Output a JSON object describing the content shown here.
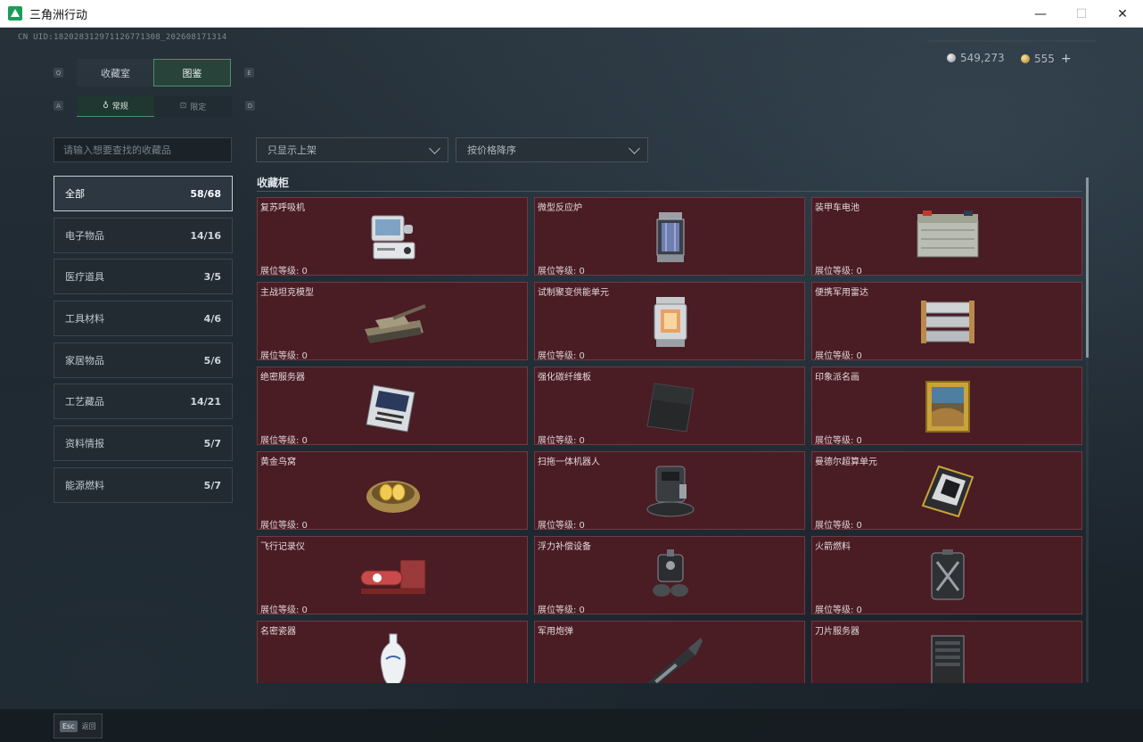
{
  "window": {
    "title": "三角洲行动",
    "minimize": "—",
    "maximize": "☐",
    "close": "✕"
  },
  "header": {
    "uid": "CN UID:1820283129711267713­08_202608171314",
    "silver": "549,273",
    "gold": "555",
    "plus": "+"
  },
  "tabs": {
    "prev_key": "Q",
    "next_key": "E",
    "items": [
      {
        "label": "收藏室",
        "active": false
      },
      {
        "label": "图鉴",
        "active": true
      }
    ]
  },
  "subtabs": {
    "prev_key": "A",
    "next_key": "D",
    "items": [
      {
        "label": "常规",
        "icon": "bag-icon",
        "glyph": "♁",
        "active": true
      },
      {
        "label": "限定",
        "icon": "limited-icon",
        "glyph": "⊡",
        "active": false
      }
    ]
  },
  "search": {
    "placeholder": "请输入想要查找的收藏品"
  },
  "filters": {
    "display": "只显示上架",
    "sort": "按价格降序"
  },
  "categories": [
    {
      "label": "全部",
      "count": "58/68",
      "active": true
    },
    {
      "label": "电子物品",
      "count": "14/16",
      "active": false
    },
    {
      "label": "医疗道具",
      "count": "3/5",
      "active": false
    },
    {
      "label": "工具材料",
      "count": "4/6",
      "active": false
    },
    {
      "label": "家居物品",
      "count": "5/6",
      "active": false
    },
    {
      "label": "工艺藏品",
      "count": "14/21",
      "active": false
    },
    {
      "label": "资料情报",
      "count": "5/7",
      "active": false
    },
    {
      "label": "能源燃料",
      "count": "5/7",
      "active": false
    }
  ],
  "cabinet": {
    "title": "收藏柜",
    "level_label": "展位等级: 0",
    "items": [
      {
        "name": "复苏呼吸机",
        "icon": "ventilator-icon"
      },
      {
        "name": "微型反应炉",
        "icon": "reactor-icon"
      },
      {
        "name": "装甲车电池",
        "icon": "battery-icon"
      },
      {
        "name": "主战坦克模型",
        "icon": "tank-icon"
      },
      {
        "name": "试制聚变供能单元",
        "icon": "fusion-unit-icon"
      },
      {
        "name": "便携军用雷达",
        "icon": "radar-icon"
      },
      {
        "name": "绝密服务器",
        "icon": "server-board-icon"
      },
      {
        "name": "强化碳纤维板",
        "icon": "carbon-plate-icon"
      },
      {
        "name": "印象派名画",
        "icon": "painting-icon"
      },
      {
        "name": "黄金鸟窝",
        "icon": "gold-nest-icon"
      },
      {
        "name": "扫拖一体机器人",
        "icon": "robot-vacuum-icon"
      },
      {
        "name": "曼德尔超算单元",
        "icon": "supercomputer-icon"
      },
      {
        "name": "飞行记录仪",
        "icon": "flight-recorder-icon"
      },
      {
        "name": "浮力补偿设备",
        "icon": "buoyancy-device-icon"
      },
      {
        "name": "火箭燃料",
        "icon": "rocket-fuel-icon"
      },
      {
        "name": "名密瓷器",
        "icon": "porcelain-icon"
      },
      {
        "name": "军用炮弹",
        "icon": "shell-icon"
      },
      {
        "name": "刀片服务器",
        "icon": "blade-server-icon"
      }
    ]
  },
  "footer": {
    "esc_key": "Esc",
    "back_label": "返回"
  }
}
